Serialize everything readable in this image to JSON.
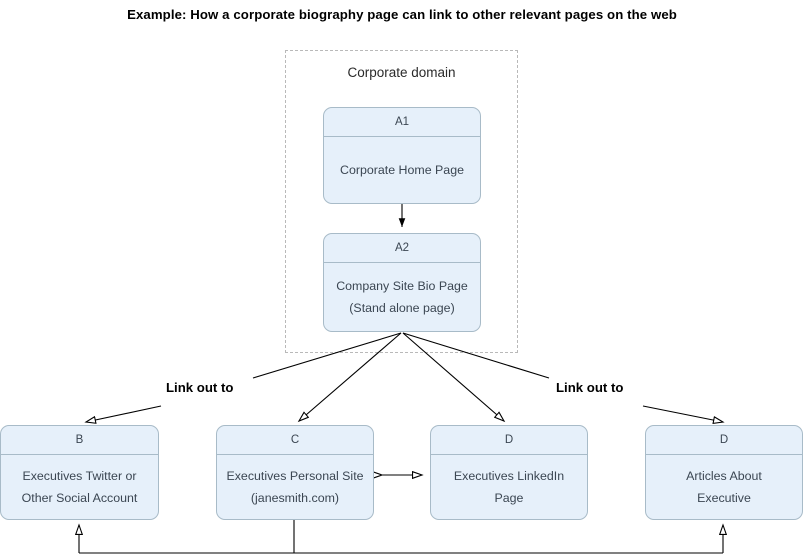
{
  "title": "Example:  How a corporate biography page can link to other relevant pages on the web",
  "domain_group": {
    "label": "Corporate domain"
  },
  "nodes": {
    "a1": {
      "id": "A1",
      "line1": "Corporate Home Page",
      "line2": ""
    },
    "a2": {
      "id": "A2",
      "line1": "Company Site Bio Page",
      "line2": "(Stand alone page)"
    },
    "b": {
      "id": "B",
      "line1": "Executives Twitter or",
      "line2": "Other Social Account"
    },
    "c": {
      "id": "C",
      "line1": "Executives Personal Site",
      "line2": "(janesmith.com)"
    },
    "d1": {
      "id": "D",
      "line1": "Executives LinkedIn",
      "line2": "Page"
    },
    "d2": {
      "id": "D",
      "line1": "Articles About",
      "line2": "Executive"
    }
  },
  "annotations": {
    "link_out_left": "Link out to",
    "link_out_right": "Link out to"
  },
  "colors": {
    "node_fill": "#e6f0fa",
    "node_border": "#a8bbc8",
    "node_text": "#3b4652",
    "group_border": "#b9b9b9",
    "connector": "#000000",
    "title_text": "#000000",
    "background": "#ffffff"
  }
}
